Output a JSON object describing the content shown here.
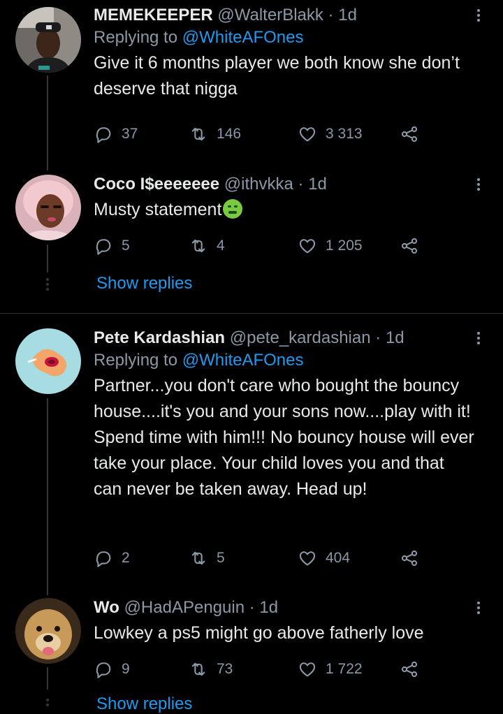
{
  "tweets": [
    {
      "name": "MEMEKEEPER",
      "handle": "@WalterBlakk",
      "time": "1d",
      "replying_prefix": "Replying to",
      "replying_to": "@WhiteAFOnes",
      "text": "Give it 6 months player we both know she don’t deserve that nigga",
      "replies": "37",
      "retweets": "146",
      "likes": "3 313"
    },
    {
      "name": "Coco I$eeeeeee",
      "handle": "@ithvkka",
      "time": "1d",
      "text": "Musty statement",
      "emoji": "nauseated-face-icon",
      "replies": "5",
      "retweets": "4",
      "likes": "1 205"
    },
    {
      "name": "Pete Kardashian",
      "handle": "@pete_kardashian",
      "time": "1d",
      "replying_prefix": "Replying to",
      "replying_to": "@WhiteAFOnes",
      "text": "Partner...you don't care who bought the bouncy house....it's you and your sons now....play with it! Spend time with him!!! No bouncy house will ever take your place. Your child loves you and that can never be taken away. Head up!",
      "replies": "2",
      "retweets": "5",
      "likes": "404"
    },
    {
      "name": "Wo",
      "handle": "@HadAPenguin",
      "time": "1d",
      "text": "Lowkey a ps5 might go above fatherly love",
      "replies": "9",
      "retweets": "73",
      "likes": "1 722"
    }
  ],
  "show_replies_label": "Show replies",
  "show_replies_label_2": "Show replies",
  "separator": "·",
  "colors": {
    "background": "#000000",
    "text": "#e7e9ea",
    "muted": "#8b98a5",
    "accent": "#1d9bf0",
    "line": "#333639"
  }
}
